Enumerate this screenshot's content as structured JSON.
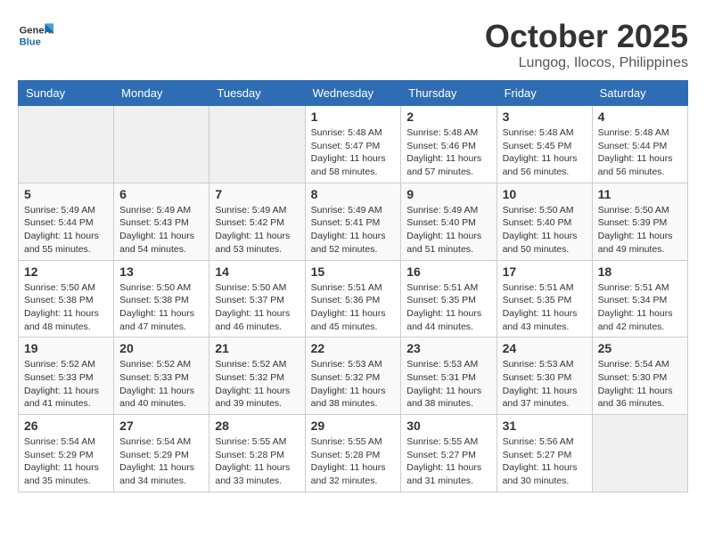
{
  "header": {
    "logo_text_general": "General",
    "logo_text_blue": "Blue",
    "month": "October 2025",
    "location": "Lungog, Ilocos, Philippines"
  },
  "weekdays": [
    "Sunday",
    "Monday",
    "Tuesday",
    "Wednesday",
    "Thursday",
    "Friday",
    "Saturday"
  ],
  "weeks": [
    [
      {
        "day": "",
        "sunrise": "",
        "sunset": "",
        "daylight": ""
      },
      {
        "day": "",
        "sunrise": "",
        "sunset": "",
        "daylight": ""
      },
      {
        "day": "",
        "sunrise": "",
        "sunset": "",
        "daylight": ""
      },
      {
        "day": "1",
        "sunrise": "Sunrise: 5:48 AM",
        "sunset": "Sunset: 5:47 PM",
        "daylight": "Daylight: 11 hours and 58 minutes."
      },
      {
        "day": "2",
        "sunrise": "Sunrise: 5:48 AM",
        "sunset": "Sunset: 5:46 PM",
        "daylight": "Daylight: 11 hours and 57 minutes."
      },
      {
        "day": "3",
        "sunrise": "Sunrise: 5:48 AM",
        "sunset": "Sunset: 5:45 PM",
        "daylight": "Daylight: 11 hours and 56 minutes."
      },
      {
        "day": "4",
        "sunrise": "Sunrise: 5:48 AM",
        "sunset": "Sunset: 5:44 PM",
        "daylight": "Daylight: 11 hours and 56 minutes."
      }
    ],
    [
      {
        "day": "5",
        "sunrise": "Sunrise: 5:49 AM",
        "sunset": "Sunset: 5:44 PM",
        "daylight": "Daylight: 11 hours and 55 minutes."
      },
      {
        "day": "6",
        "sunrise": "Sunrise: 5:49 AM",
        "sunset": "Sunset: 5:43 PM",
        "daylight": "Daylight: 11 hours and 54 minutes."
      },
      {
        "day": "7",
        "sunrise": "Sunrise: 5:49 AM",
        "sunset": "Sunset: 5:42 PM",
        "daylight": "Daylight: 11 hours and 53 minutes."
      },
      {
        "day": "8",
        "sunrise": "Sunrise: 5:49 AM",
        "sunset": "Sunset: 5:41 PM",
        "daylight": "Daylight: 11 hours and 52 minutes."
      },
      {
        "day": "9",
        "sunrise": "Sunrise: 5:49 AM",
        "sunset": "Sunset: 5:40 PM",
        "daylight": "Daylight: 11 hours and 51 minutes."
      },
      {
        "day": "10",
        "sunrise": "Sunrise: 5:50 AM",
        "sunset": "Sunset: 5:40 PM",
        "daylight": "Daylight: 11 hours and 50 minutes."
      },
      {
        "day": "11",
        "sunrise": "Sunrise: 5:50 AM",
        "sunset": "Sunset: 5:39 PM",
        "daylight": "Daylight: 11 hours and 49 minutes."
      }
    ],
    [
      {
        "day": "12",
        "sunrise": "Sunrise: 5:50 AM",
        "sunset": "Sunset: 5:38 PM",
        "daylight": "Daylight: 11 hours and 48 minutes."
      },
      {
        "day": "13",
        "sunrise": "Sunrise: 5:50 AM",
        "sunset": "Sunset: 5:38 PM",
        "daylight": "Daylight: 11 hours and 47 minutes."
      },
      {
        "day": "14",
        "sunrise": "Sunrise: 5:50 AM",
        "sunset": "Sunset: 5:37 PM",
        "daylight": "Daylight: 11 hours and 46 minutes."
      },
      {
        "day": "15",
        "sunrise": "Sunrise: 5:51 AM",
        "sunset": "Sunset: 5:36 PM",
        "daylight": "Daylight: 11 hours and 45 minutes."
      },
      {
        "day": "16",
        "sunrise": "Sunrise: 5:51 AM",
        "sunset": "Sunset: 5:35 PM",
        "daylight": "Daylight: 11 hours and 44 minutes."
      },
      {
        "day": "17",
        "sunrise": "Sunrise: 5:51 AM",
        "sunset": "Sunset: 5:35 PM",
        "daylight": "Daylight: 11 hours and 43 minutes."
      },
      {
        "day": "18",
        "sunrise": "Sunrise: 5:51 AM",
        "sunset": "Sunset: 5:34 PM",
        "daylight": "Daylight: 11 hours and 42 minutes."
      }
    ],
    [
      {
        "day": "19",
        "sunrise": "Sunrise: 5:52 AM",
        "sunset": "Sunset: 5:33 PM",
        "daylight": "Daylight: 11 hours and 41 minutes."
      },
      {
        "day": "20",
        "sunrise": "Sunrise: 5:52 AM",
        "sunset": "Sunset: 5:33 PM",
        "daylight": "Daylight: 11 hours and 40 minutes."
      },
      {
        "day": "21",
        "sunrise": "Sunrise: 5:52 AM",
        "sunset": "Sunset: 5:32 PM",
        "daylight": "Daylight: 11 hours and 39 minutes."
      },
      {
        "day": "22",
        "sunrise": "Sunrise: 5:53 AM",
        "sunset": "Sunset: 5:32 PM",
        "daylight": "Daylight: 11 hours and 38 minutes."
      },
      {
        "day": "23",
        "sunrise": "Sunrise: 5:53 AM",
        "sunset": "Sunset: 5:31 PM",
        "daylight": "Daylight: 11 hours and 38 minutes."
      },
      {
        "day": "24",
        "sunrise": "Sunrise: 5:53 AM",
        "sunset": "Sunset: 5:30 PM",
        "daylight": "Daylight: 11 hours and 37 minutes."
      },
      {
        "day": "25",
        "sunrise": "Sunrise: 5:54 AM",
        "sunset": "Sunset: 5:30 PM",
        "daylight": "Daylight: 11 hours and 36 minutes."
      }
    ],
    [
      {
        "day": "26",
        "sunrise": "Sunrise: 5:54 AM",
        "sunset": "Sunset: 5:29 PM",
        "daylight": "Daylight: 11 hours and 35 minutes."
      },
      {
        "day": "27",
        "sunrise": "Sunrise: 5:54 AM",
        "sunset": "Sunset: 5:29 PM",
        "daylight": "Daylight: 11 hours and 34 minutes."
      },
      {
        "day": "28",
        "sunrise": "Sunrise: 5:55 AM",
        "sunset": "Sunset: 5:28 PM",
        "daylight": "Daylight: 11 hours and 33 minutes."
      },
      {
        "day": "29",
        "sunrise": "Sunrise: 5:55 AM",
        "sunset": "Sunset: 5:28 PM",
        "daylight": "Daylight: 11 hours and 32 minutes."
      },
      {
        "day": "30",
        "sunrise": "Sunrise: 5:55 AM",
        "sunset": "Sunset: 5:27 PM",
        "daylight": "Daylight: 11 hours and 31 minutes."
      },
      {
        "day": "31",
        "sunrise": "Sunrise: 5:56 AM",
        "sunset": "Sunset: 5:27 PM",
        "daylight": "Daylight: 11 hours and 30 minutes."
      },
      {
        "day": "",
        "sunrise": "",
        "sunset": "",
        "daylight": ""
      }
    ]
  ]
}
